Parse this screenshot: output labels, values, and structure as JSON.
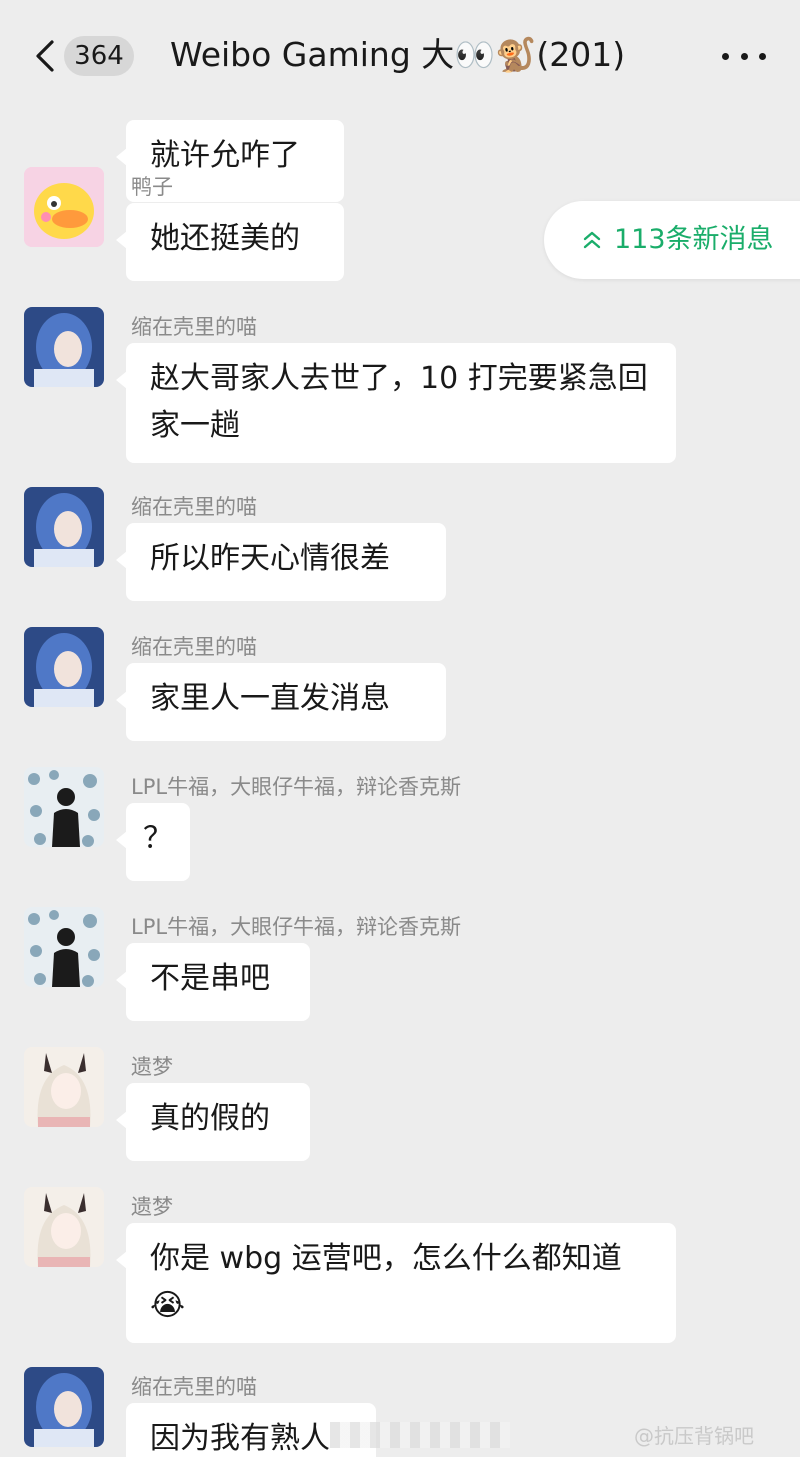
{
  "header": {
    "back_count": "364",
    "chat_title": "Weibo Gaming  大👀🐒(201)"
  },
  "new_messages_label": "113条新消息",
  "top_fragment": "就许允咋了",
  "messages": [
    {
      "sender": "鸭子",
      "text": "她还挺美的",
      "avatar": "duck-avatar"
    },
    {
      "sender": "缩在壳里的喵",
      "text": "赵大哥家人去世了，10 打完要紧急回家一趟",
      "avatar": "blue-hair-girl-avatar"
    },
    {
      "sender": "缩在壳里的喵",
      "text": "所以昨天心情很差",
      "avatar": "blue-hair-girl-avatar"
    },
    {
      "sender": "缩在壳里的喵",
      "text": "家里人一直发消息",
      "avatar": "blue-hair-girl-avatar"
    },
    {
      "sender": "LPL牛福，大眼仔牛福，辩论香克斯",
      "text": "？",
      "avatar": "silhouette-avatar"
    },
    {
      "sender": "LPL牛福，大眼仔牛福，辩论香克斯",
      "text": "不是串吧",
      "avatar": "silhouette-avatar"
    },
    {
      "sender": "遗梦",
      "text": "真的假的",
      "avatar": "anime-girl-avatar"
    },
    {
      "sender": "遗梦",
      "text": "你是 wbg 运营吧，怎么什么都知道😭",
      "avatar": "anime-girl-avatar"
    },
    {
      "sender": "缩在壳里的喵",
      "text": "因为我有熟人",
      "avatar": "blue-hair-girl-avatar"
    }
  ],
  "watermark": "@抗压背锅吧",
  "colors": {
    "background": "#ededed",
    "bubble": "#ffffff",
    "accent_green": "#1aad6a",
    "sender_gray": "#8a8a8a"
  }
}
